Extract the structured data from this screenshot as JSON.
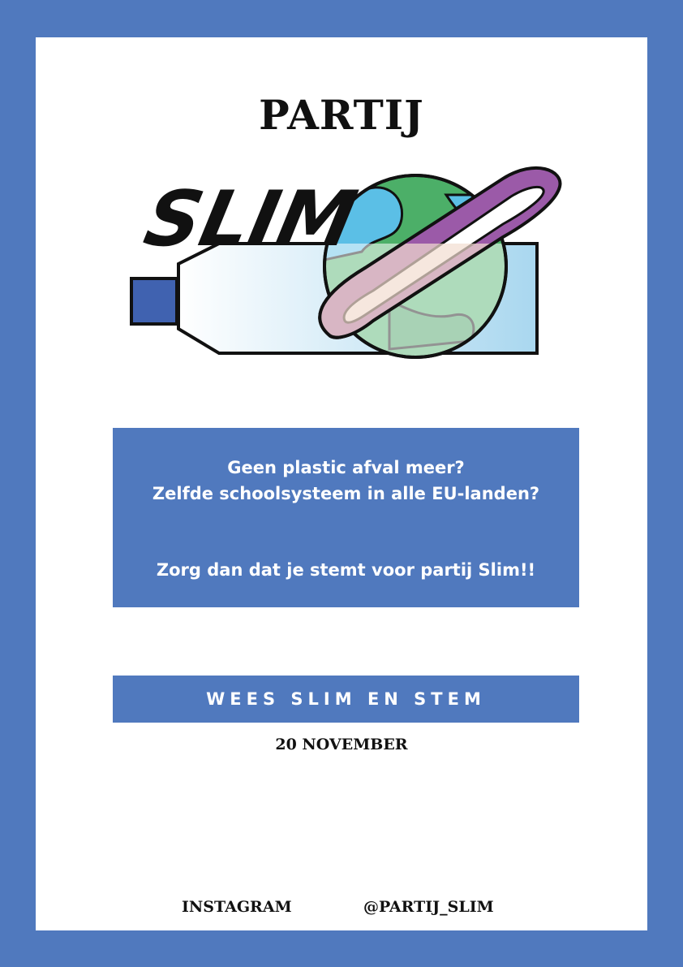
{
  "header": {
    "title": "PARTIJ"
  },
  "logo": {
    "wordmark": "SLIM",
    "icon": "bottle-globe-ring-logo"
  },
  "info_box": {
    "question_1": "Geen plastic afval meer?",
    "question_2": "Zelfde schoolsysteem in alle EU-landen?",
    "call_to_action": "Zorg dan dat je stemt voor partij Slim!!"
  },
  "banner": {
    "text": "WEES SLIM EN STEM"
  },
  "date": "20 NOVEMBER",
  "footer": {
    "label": "INSTAGRAM",
    "handle": "@PARTIJ_SLIM"
  },
  "colors": {
    "frame": "#5079be",
    "page": "#ffffff",
    "text_dark": "#111111",
    "text_light": "#ffffff",
    "globe_land": "#4caf68",
    "globe_water": "#5bbfe6",
    "ring": "#9b5aa8",
    "bottle_cap": "#4062b0"
  }
}
